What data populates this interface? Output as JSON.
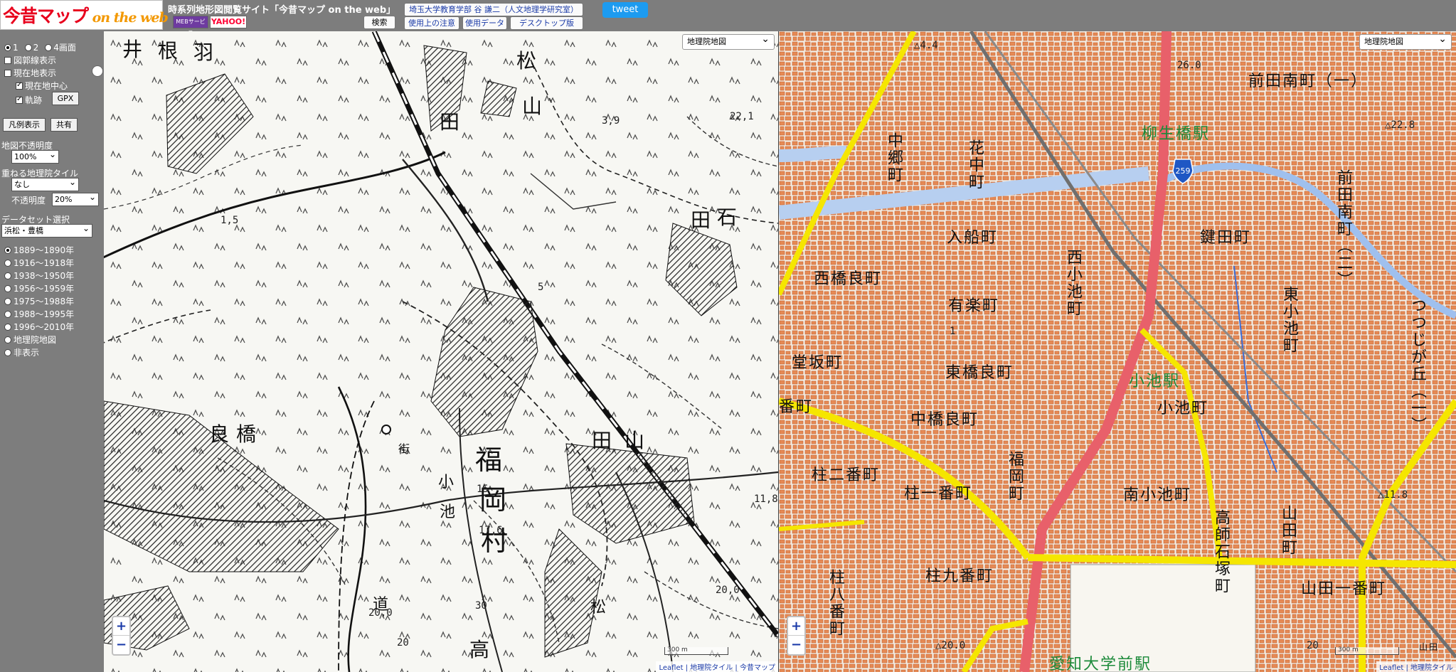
{
  "header": {
    "logo_main": "今昔マップ",
    "logo_sub": " on the web",
    "title": "時系列地形図閲覧サイト「今昔マップ on the web」",
    "banner_meb": "MEBサービス",
    "banner_yahoo": "YAHOO!",
    "search_label": "検索",
    "author_label": "埼玉大学教育学部 谷 謙二（人文地理学研究室）",
    "notice_label": "使用上の注意",
    "data_label": "使用データ",
    "desktop_label": "デスクトップ版",
    "tweet_label": "tweet"
  },
  "sidebar": {
    "screens": [
      {
        "label": "1",
        "selected": true
      },
      {
        "label": "2",
        "selected": false
      },
      {
        "label": "4画面",
        "selected": false
      }
    ],
    "legend_line": "図郭線表示",
    "current_location": "現在地表示",
    "current_center": "現在地中心",
    "track": "軌跡",
    "gpx_label": "GPX",
    "legend_button": "凡例表示",
    "share_button": "共有",
    "opacity_label": "地図不透明度",
    "opacity_value": "100%",
    "overlay_label": "重ねる地理院タイル",
    "overlay_value": "なし",
    "overlay_opacity_label": "不透明度",
    "overlay_opacity_value": "20%",
    "dataset_label": "データセット選択",
    "dataset_value": "浜松・豊橋",
    "eras": [
      {
        "label": "1889～1890年",
        "selected": true
      },
      {
        "label": "1916～1918年",
        "selected": false
      },
      {
        "label": "1938～1950年",
        "selected": false
      },
      {
        "label": "1956～1959年",
        "selected": false
      },
      {
        "label": "1975～1988年",
        "selected": false
      },
      {
        "label": "1988～1995年",
        "selected": false
      },
      {
        "label": "1996～2010年",
        "selected": false
      },
      {
        "label": "地理院地図",
        "selected": false
      },
      {
        "label": "非表示",
        "selected": false
      }
    ],
    "collapse_icon": "‹"
  },
  "left_map": {
    "layer_select": "地理院地図",
    "labels": [
      "井",
      "根",
      "羽",
      "松",
      "山",
      "田",
      "石",
      "田",
      "良",
      "橋",
      "福",
      "岡",
      "村",
      "小",
      "池",
      "田",
      "山",
      "街",
      "道",
      "高",
      "松"
    ],
    "spot_heights": [
      "22,1",
      "3,9",
      "1,5",
      "5",
      "11,8",
      "20,0",
      "20,0",
      "20",
      "30",
      "17,6",
      "15"
    ],
    "zoom_in": "+",
    "zoom_out": "−",
    "scale_label": "300 m",
    "attribution": "Leaflet | 地理院タイル | 今昔マップ"
  },
  "right_map": {
    "layer_select": "地理院地図",
    "town_names": [
      "前田南町（一）",
      "中郷町",
      "花中町",
      "入船町",
      "西小池町",
      "鍵田町",
      "前田南町（二）",
      "西橋良町",
      "有楽町",
      "東小池町",
      "つつじが丘（一）",
      "堂坂町",
      "東橋良町",
      "小池町",
      "番町",
      "中橋良町",
      "柱二番町",
      "柱一番町",
      "福岡町",
      "南小池町",
      "高師石塚町",
      "山田町",
      "柱八番町",
      "柱九番町",
      "山田一番町",
      "愛知大学前駅",
      "山田"
    ],
    "stations": [
      "柳生橋駅",
      "小池駅"
    ],
    "route_shield": "259",
    "elevations": [
      "△4.4",
      "26.0",
      "△22.8",
      "△11.8",
      "△20.0",
      "20",
      "1"
    ],
    "zoom_in": "+",
    "zoom_out": "−",
    "scale_label": "300 m",
    "attribution": "Leaflet | 地理院タイル"
  },
  "colors": {
    "header_bg": "#7d7d7d",
    "logo_red": "#e8001c",
    "tweet_blue": "#1d9bf0",
    "building_orange": "#e07a45",
    "road_yellow": "#f5e600",
    "rail_red": "#e8606a",
    "river_blue": "#b7cff0"
  }
}
